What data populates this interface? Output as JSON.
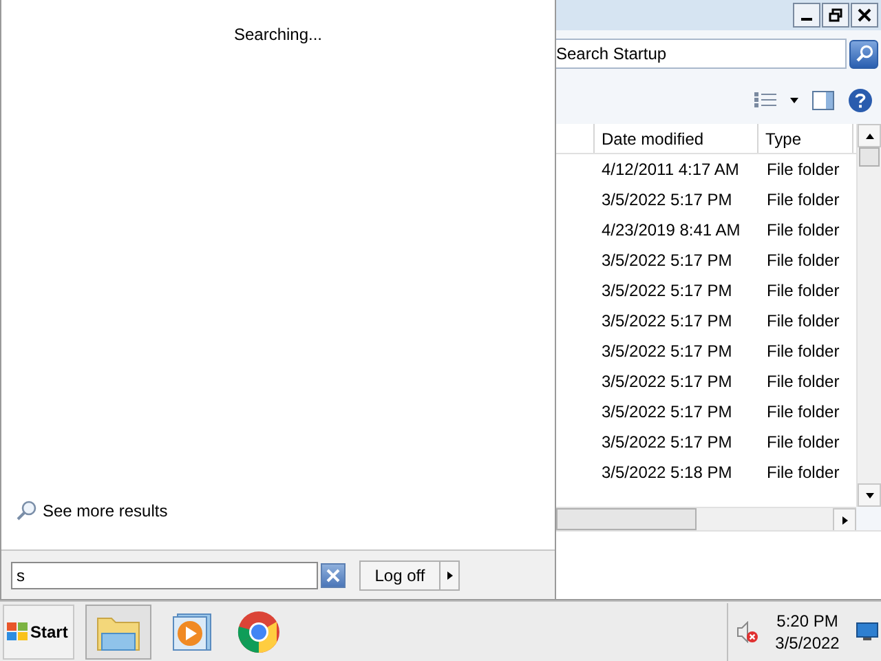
{
  "start_menu": {
    "status": "Searching...",
    "more_results": "See more results",
    "search": {
      "value": "s"
    },
    "power_button": "Log off"
  },
  "explorer": {
    "search": {
      "placeholder": "Search Startup"
    },
    "columns": [
      "Date modified",
      "Type"
    ],
    "rows": [
      {
        "date_modified": "4/12/2011 4:17 AM",
        "type": "File folder"
      },
      {
        "date_modified": "3/5/2022 5:17 PM",
        "type": "File folder"
      },
      {
        "date_modified": "4/23/2019 8:41 AM",
        "type": "File folder"
      },
      {
        "date_modified": "3/5/2022 5:17 PM",
        "type": "File folder"
      },
      {
        "date_modified": "3/5/2022 5:17 PM",
        "type": "File folder"
      },
      {
        "date_modified": "3/5/2022 5:17 PM",
        "type": "File folder"
      },
      {
        "date_modified": "3/5/2022 5:17 PM",
        "type": "File folder"
      },
      {
        "date_modified": "3/5/2022 5:17 PM",
        "type": "File folder"
      },
      {
        "date_modified": "3/5/2022 5:17 PM",
        "type": "File folder"
      },
      {
        "date_modified": "3/5/2022 5:17 PM",
        "type": "File folder"
      },
      {
        "date_modified": "3/5/2022 5:18 PM",
        "type": "File folder"
      }
    ]
  },
  "taskbar": {
    "start": "Start",
    "clock": {
      "time": "5:20 PM",
      "date": "3/5/2022"
    }
  }
}
